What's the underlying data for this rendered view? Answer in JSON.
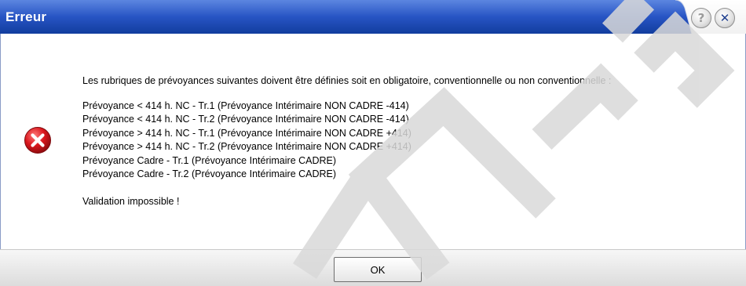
{
  "dialog": {
    "title": "Erreur",
    "help_icon": "question-icon",
    "close_icon": "close-icon",
    "error_icon": "error-icon"
  },
  "message": {
    "intro": "Les rubriques de prévoyances suivantes doivent être définies soit en obligatoire, conventionnelle ou non conventionnelle :",
    "items": [
      "Prévoyance < 414 h. NC - Tr.1 (Prévoyance Intérimaire NON CADRE -414)",
      "Prévoyance < 414 h. NC - Tr.2 (Prévoyance Intérimaire NON CADRE -414)",
      "Prévoyance > 414 h. NC - Tr.1 (Prévoyance Intérimaire NON CADRE +414)",
      "Prévoyance > 414 h. NC - Tr.2 (Prévoyance Intérimaire NON CADRE +414)",
      "Prévoyance Cadre - Tr.1 (Prévoyance Intérimaire CADRE)",
      "Prévoyance Cadre - Tr.2 (Prévoyance Intérimaire CADRE)"
    ],
    "footer": "Validation impossible !"
  },
  "buttons": {
    "ok_label": "OK"
  },
  "colors": {
    "title_bar": "#1f49b6",
    "error_red": "#d0161b",
    "watermark": "#d9d9d9"
  }
}
